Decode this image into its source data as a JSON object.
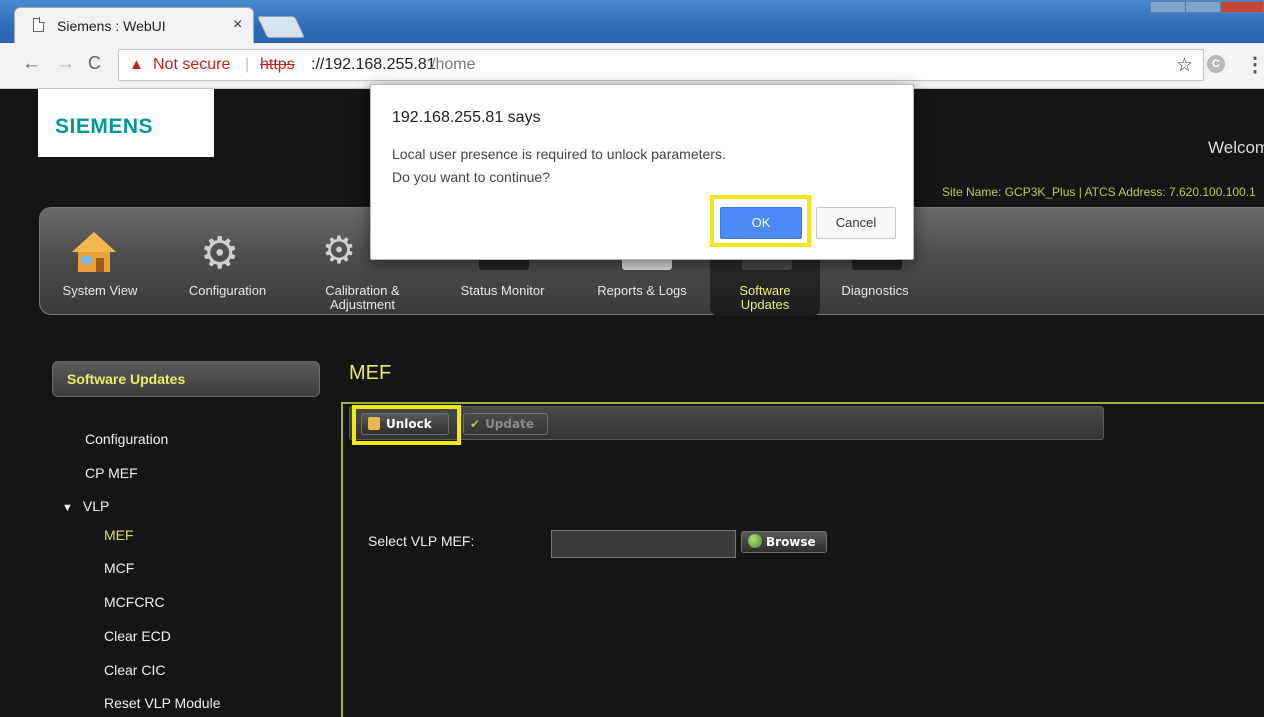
{
  "browser": {
    "tab_title": "Siemens : WebUI",
    "tab_close": "×",
    "security_text": "Not secure",
    "url_scheme": "https",
    "url_host": "://192.168.255.81",
    "url_path": "/home",
    "separator": "|",
    "nav_back": "←",
    "nav_forward": "→",
    "nav_reload": "C",
    "star": "☆",
    "menu": "⋮"
  },
  "header": {
    "logo": "SIEMENS",
    "welcome": "Welcome",
    "site_info": "Site Name: GCP3K_Plus | ATCS Address: 7.620.100.100.1"
  },
  "toolbar": {
    "items": [
      {
        "label": "System View"
      },
      {
        "label": "Configuration"
      },
      {
        "label": "Calibration & Adjustment"
      },
      {
        "label": "Status Monitor"
      },
      {
        "label": "Reports & Logs"
      },
      {
        "label": "Software Updates",
        "active": true
      },
      {
        "label": "Diagnostics"
      }
    ]
  },
  "sidebar": {
    "header": "Software Updates",
    "items": [
      {
        "label": "Configuration"
      },
      {
        "label": "CP MEF"
      },
      {
        "label": "VLP",
        "expanded": true
      },
      {
        "label": "MEF",
        "active": true
      },
      {
        "label": "MCF"
      },
      {
        "label": "MCFCRC"
      },
      {
        "label": "Clear ECD"
      },
      {
        "label": "Clear CIC"
      },
      {
        "label": "Reset VLP Module"
      }
    ]
  },
  "content": {
    "title": "MEF",
    "unlock_label": "Unlock",
    "update_label": "Update",
    "select_label": "Select VLP MEF:",
    "file_value": "",
    "browse_label": "Browse"
  },
  "dialog": {
    "title": "192.168.255.81 says",
    "message_line1": "Local user presence is required to unlock parameters.",
    "message_line2": "Do you want to continue?",
    "ok_label": "OK",
    "cancel_label": "Cancel"
  },
  "colors": {
    "highlight": "#f3e814",
    "accent": "#e2ee6a",
    "ok_button": "#4c8bf5"
  }
}
